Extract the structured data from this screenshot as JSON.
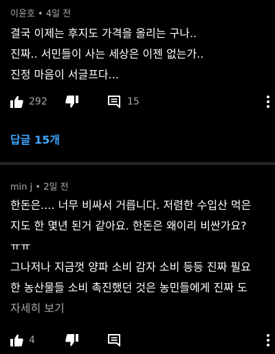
{
  "comments": [
    {
      "author": "이윤호",
      "separator": "•",
      "time": "4일 전",
      "lines": [
        "결국 이제는 후지도 가격을 올리는 구나..",
        "진짜.. 서민들이 사는 세상은 이젠 없는가..",
        "진정 마음이 서글프다..."
      ],
      "likes": "292",
      "reply_count": "15",
      "replies_link": "답글 15개"
    },
    {
      "author": "min j",
      "separator": "•",
      "time": "2일 전",
      "lines": [
        "한돈은.... 너무 비싸서 거릅니다. 저렴한 수입산 먹은",
        "지도 한 몇년 된거 같아요. 한돈은 왜이리 비싼가요?",
        "ㅠㅠ",
        "그나저나 지금껏 양파 소비 감자 소비 등등 진짜 필요",
        "한 농산물들 소비 촉진했던 것은 농민들에게 진짜 도"
      ],
      "read_more": "자세히 보기",
      "likes": "4"
    }
  ],
  "colors": {
    "background": "#000000",
    "text": "#ffffff",
    "secondary": "#aaaaaa",
    "link": "#3ea6ff",
    "divider": "#262626"
  },
  "icons": [
    "like-icon",
    "dislike-icon",
    "reply-icon",
    "more-vert-icon"
  ]
}
